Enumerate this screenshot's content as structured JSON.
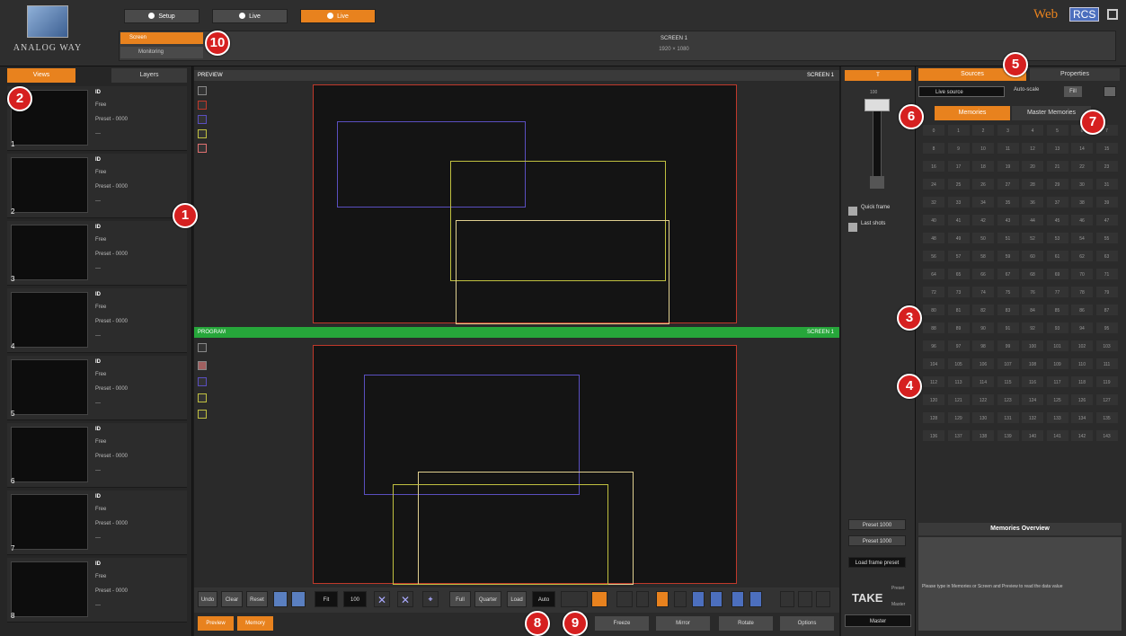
{
  "header": {
    "logo_text": "ANALOG WAY",
    "brand_prefix": "Web",
    "brand_suffix": "RCS",
    "top_tabs": [
      "Setup",
      "Live",
      "Live"
    ],
    "room_active": "Screen",
    "room_second": "Monitoring",
    "room_center_line1": "SCREEN 1",
    "room_center_line2": "1920 × 1080"
  },
  "left": {
    "tab_views": "Views",
    "tab_layers": "Layers",
    "presets": [
      {
        "num": "1",
        "id": "ID",
        "line2": "Free",
        "line3": "Preset - 0000",
        "line4": "---"
      },
      {
        "num": "2",
        "id": "ID",
        "line2": "Free",
        "line3": "Preset - 0000",
        "line4": "---"
      },
      {
        "num": "3",
        "id": "ID",
        "line2": "Free",
        "line3": "Preset - 0000",
        "line4": "---"
      },
      {
        "num": "4",
        "id": "ID",
        "line2": "Free",
        "line3": "Preset - 0000",
        "line4": "---"
      },
      {
        "num": "5",
        "id": "ID",
        "line2": "Free",
        "line3": "Preset - 0000",
        "line4": "---"
      },
      {
        "num": "6",
        "id": "ID",
        "line2": "Free",
        "line3": "Preset - 0000",
        "line4": "---"
      },
      {
        "num": "7",
        "id": "ID",
        "line2": "Free",
        "line3": "Preset - 0000",
        "line4": "---"
      },
      {
        "num": "8",
        "id": "ID",
        "line2": "Free",
        "line3": "Preset - 0000",
        "line4": "---"
      }
    ]
  },
  "center": {
    "preview_label": "PREVIEW",
    "preview_right": "SCREEN 1",
    "program_label": "PROGRAM",
    "program_right": "SCREEN 1",
    "toolbar": [
      "Undo",
      "Clear",
      "Reset",
      "Fit",
      "100",
      "Full",
      "Quarter",
      "Load",
      "Auto"
    ],
    "bottom_left": [
      "Preview",
      "Memory"
    ],
    "bottom_right": [
      "Freeze",
      "Mirror",
      "Rotate",
      "Options"
    ]
  },
  "middle": {
    "top_label": "T",
    "fader_label": "100",
    "item1": "Quick frame",
    "item2": "Last shots",
    "btn1": "Preset 1000",
    "btn2": "Preset 1000",
    "btn3": "Load frame preset",
    "take_label": "TAKE",
    "take_small1": "Preset",
    "take_small2": "Master",
    "take_bottom": "Master"
  },
  "right": {
    "tab_sources": "Sources",
    "tab_properties": "Properties",
    "source_select": "Live source",
    "autoscale_label": "Auto-scale",
    "fill_btn": "Fill",
    "subtab_a": "Memories",
    "subtab_b": "Master Memories",
    "grid_cells": [
      "0",
      "1",
      "2",
      "3",
      "4",
      "5",
      "6",
      "7",
      "8",
      "9",
      "10",
      "11",
      "12",
      "13",
      "14",
      "15",
      "16",
      "17",
      "18",
      "19",
      "20",
      "21",
      "22",
      "23",
      "24",
      "25",
      "26",
      "27",
      "28",
      "29",
      "30",
      "31",
      "32",
      "33",
      "34",
      "35",
      "36",
      "37",
      "38",
      "39",
      "40",
      "41",
      "42",
      "43",
      "44",
      "45",
      "46",
      "47",
      "48",
      "49",
      "50",
      "51",
      "52",
      "53",
      "54",
      "55",
      "56",
      "57",
      "58",
      "59",
      "60",
      "61",
      "62",
      "63",
      "64",
      "65",
      "66",
      "67",
      "68",
      "69",
      "70",
      "71",
      "72",
      "73",
      "74",
      "75",
      "76",
      "77",
      "78",
      "79",
      "80",
      "81",
      "82",
      "83",
      "84",
      "85",
      "86",
      "87",
      "88",
      "89",
      "90",
      "91",
      "92",
      "93",
      "94",
      "95",
      "96",
      "97",
      "98",
      "99",
      "100",
      "101",
      "102",
      "103",
      "104",
      "105",
      "106",
      "107",
      "108",
      "109",
      "110",
      "111",
      "112",
      "113",
      "114",
      "115",
      "116",
      "117",
      "118",
      "119",
      "120",
      "121",
      "122",
      "123",
      "124",
      "125",
      "126",
      "127",
      "128",
      "129",
      "130",
      "131",
      "132",
      "133",
      "134",
      "135",
      "136",
      "137",
      "138",
      "139",
      "140",
      "141",
      "142",
      "143"
    ],
    "overview_title": "Memories Overview",
    "overview_text": "Please type in Memories or Screen and Preview to read the data value"
  },
  "callouts": [
    "1",
    "2",
    "3",
    "4",
    "5",
    "6",
    "7",
    "8",
    "9",
    "10"
  ],
  "colors": {
    "accent": "#e8821e",
    "program": "#26a63a",
    "callout": "#d62020",
    "brand_blue": "#4c6fbe"
  }
}
